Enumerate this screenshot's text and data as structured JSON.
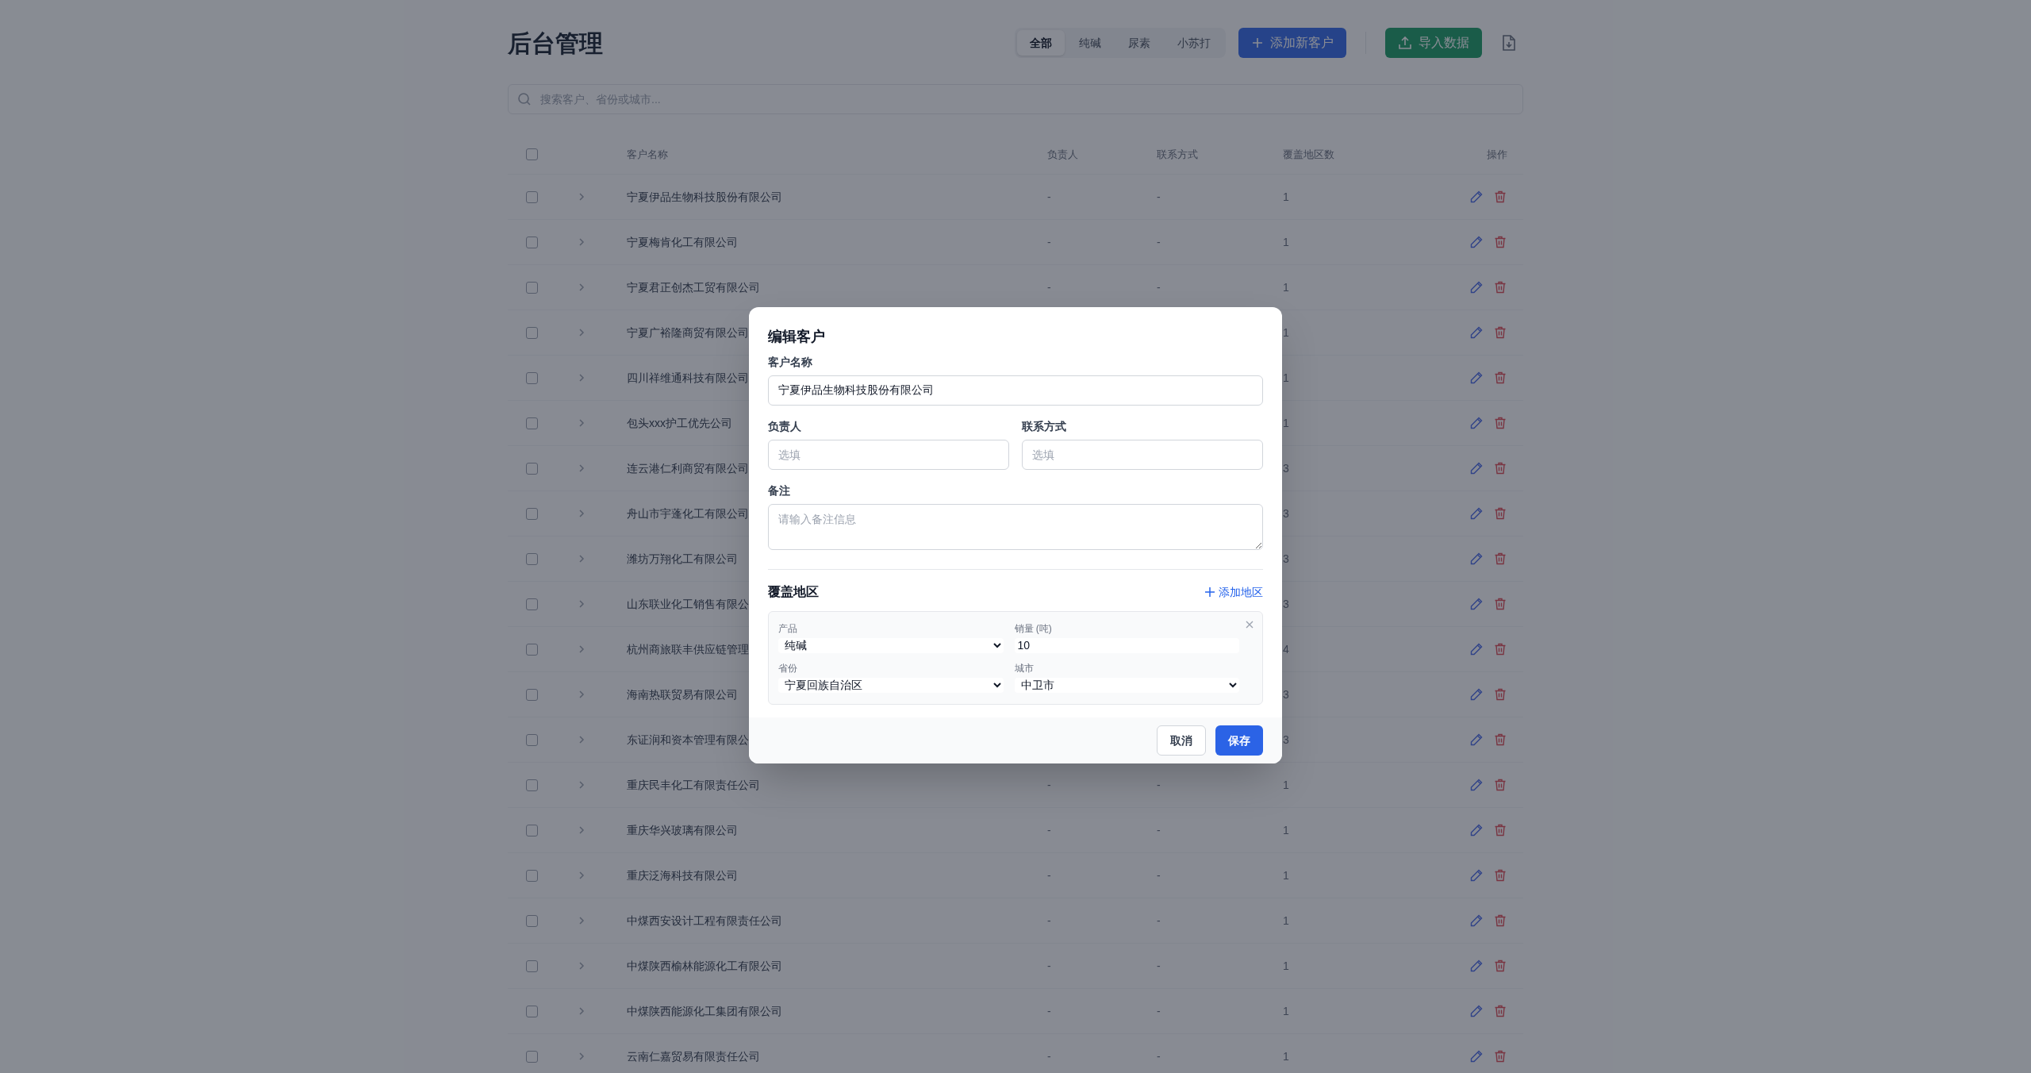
{
  "header": {
    "title": "后台管理",
    "filters": [
      {
        "label": "全部",
        "selected": true
      },
      {
        "label": "纯碱",
        "selected": false
      },
      {
        "label": "尿素",
        "selected": false
      },
      {
        "label": "小苏打",
        "selected": false
      }
    ],
    "add_button": "添加新客户",
    "import_button": "导入数据"
  },
  "search": {
    "placeholder": "搜索客户、省份或城市..."
  },
  "table": {
    "select_all_checked": false,
    "columns": [
      "客户名称",
      "负责人",
      "联系方式",
      "覆盖地区数",
      "操作"
    ],
    "rows": [
      {
        "checked": false,
        "expanded": false,
        "name": "宁夏伊品生物科技股份有限公司",
        "owner": "-",
        "contact": "-",
        "regions": "1"
      },
      {
        "checked": false,
        "expanded": false,
        "name": "宁夏梅肯化工有限公司",
        "owner": "-",
        "contact": "-",
        "regions": "1"
      },
      {
        "checked": false,
        "expanded": false,
        "name": "宁夏君正创杰工贸有限公司",
        "owner": "-",
        "contact": "-",
        "regions": "1"
      },
      {
        "checked": false,
        "expanded": false,
        "name": "宁夏广裕隆商贸有限公司",
        "regions": "1"
      },
      {
        "checked": false,
        "expanded": false,
        "name": "四川祥维通科技有限公司",
        "regions": "1"
      },
      {
        "checked": false,
        "expanded": false,
        "name": "包头xxx护工优先公司",
        "regions": "1"
      },
      {
        "checked": false,
        "expanded": false,
        "name": "连云港仁利商贸有限公司",
        "regions": "3"
      },
      {
        "checked": false,
        "expanded": false,
        "name": "舟山市宇蓬化工有限公司",
        "regions": "3"
      },
      {
        "checked": false,
        "expanded": false,
        "name": "潍坊万翔化工有限公司",
        "regions": "3"
      },
      {
        "checked": false,
        "expanded": false,
        "name": "山东联业化工销售有限公",
        "regions": "3"
      },
      {
        "checked": false,
        "expanded": false,
        "name": "杭州商旅联丰供应链管理",
        "regions": "4"
      },
      {
        "checked": false,
        "expanded": false,
        "name": "海南热联贸易有限公司",
        "regions": "3"
      },
      {
        "checked": false,
        "expanded": false,
        "name": "东证润和资本管理有限公",
        "regions": "3"
      },
      {
        "checked": false,
        "expanded": false,
        "name": "重庆民丰化工有限责任公司",
        "owner": "-",
        "contact": "-",
        "regions": "1"
      },
      {
        "checked": false,
        "expanded": false,
        "name": "重庆华兴玻璃有限公司",
        "owner": "-",
        "contact": "-",
        "regions": "1"
      },
      {
        "checked": false,
        "expanded": false,
        "name": "重庆泛海科技有限公司",
        "owner": "-",
        "contact": "-",
        "regions": "1"
      },
      {
        "checked": false,
        "expanded": false,
        "name": "中煤西安设计工程有限责任公司",
        "owner": "-",
        "contact": "-",
        "regions": "1"
      },
      {
        "checked": false,
        "expanded": false,
        "name": "中煤陕西榆林能源化工有限公司",
        "owner": "-",
        "contact": "-",
        "regions": "1"
      },
      {
        "checked": false,
        "expanded": false,
        "name": "中煤陕西能源化工集团有限公司",
        "owner": "-",
        "contact": "-",
        "regions": "1"
      },
      {
        "checked": false,
        "expanded": false,
        "name": "云南仁嘉贸易有限责任公司",
        "owner": "-",
        "contact": "-",
        "regions": "1"
      }
    ]
  },
  "modal": {
    "title": "编辑客户",
    "name_label": "客户名称",
    "name_value": "宁夏伊品生物科技股份有限公司",
    "owner_label": "负责人",
    "owner_placeholder": "选填",
    "contact_label": "联系方式",
    "contact_placeholder": "选填",
    "note_label": "备注",
    "note_placeholder": "请输入备注信息",
    "regions_heading": "覆盖地区",
    "add_region": "添加地区",
    "regions": [
      {
        "product_label": "产品",
        "product": "纯碱",
        "volume_label": "销量 (吨)",
        "volume": "10",
        "province_label": "省份",
        "province": "宁夏回族自治区",
        "city_label": "城市",
        "city": "中卫市"
      }
    ],
    "cancel": "取消",
    "save": "保存"
  }
}
